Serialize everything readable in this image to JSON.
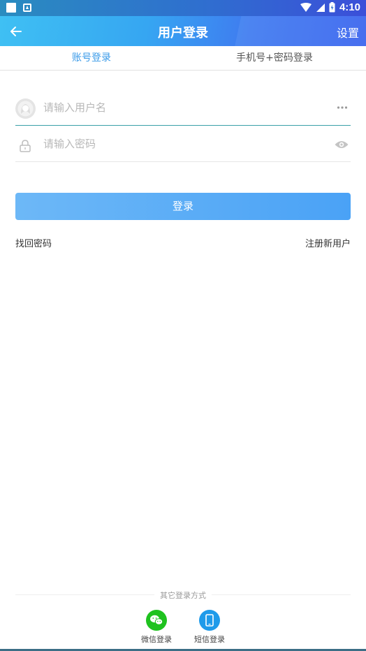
{
  "statusbar": {
    "time": "4:10"
  },
  "appbar": {
    "title": "用户登录",
    "settings_label": "设置"
  },
  "tabs": [
    {
      "label": "账号登录",
      "active": true
    },
    {
      "label": "手机号+密码登录",
      "active": false
    }
  ],
  "form": {
    "username_placeholder": "请输入用户名",
    "password_placeholder": "请输入密码",
    "login_label": "登录",
    "forgot_label": "找回密码",
    "register_label": "注册新用户"
  },
  "other_login": {
    "title": "其它登录方式",
    "options": [
      {
        "label": "微信登录",
        "icon": "wechat-icon"
      },
      {
        "label": "短信登录",
        "icon": "phone-icon"
      }
    ]
  },
  "colors": {
    "accent": "#3a9ae8",
    "button": "#5aaaf6",
    "wechat": "#1fc21f",
    "sms": "#1f9bea"
  }
}
